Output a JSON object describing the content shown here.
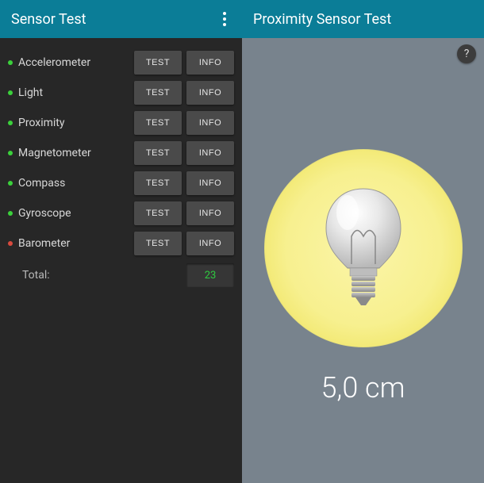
{
  "left": {
    "title": "Sensor Test",
    "sensors": [
      {
        "name": "Accelerometer",
        "status": "green"
      },
      {
        "name": "Light",
        "status": "green"
      },
      {
        "name": "Proximity",
        "status": "green"
      },
      {
        "name": "Magnetometer",
        "status": "green"
      },
      {
        "name": "Compass",
        "status": "green"
      },
      {
        "name": "Gyroscope",
        "status": "green"
      },
      {
        "name": "Barometer",
        "status": "red"
      }
    ],
    "test_label": "TEST",
    "info_label": "INFO",
    "total_label": "Total:",
    "total_value": "23"
  },
  "right": {
    "title": "Proximity Sensor Test",
    "help": "?",
    "reading": "5,0 cm"
  }
}
